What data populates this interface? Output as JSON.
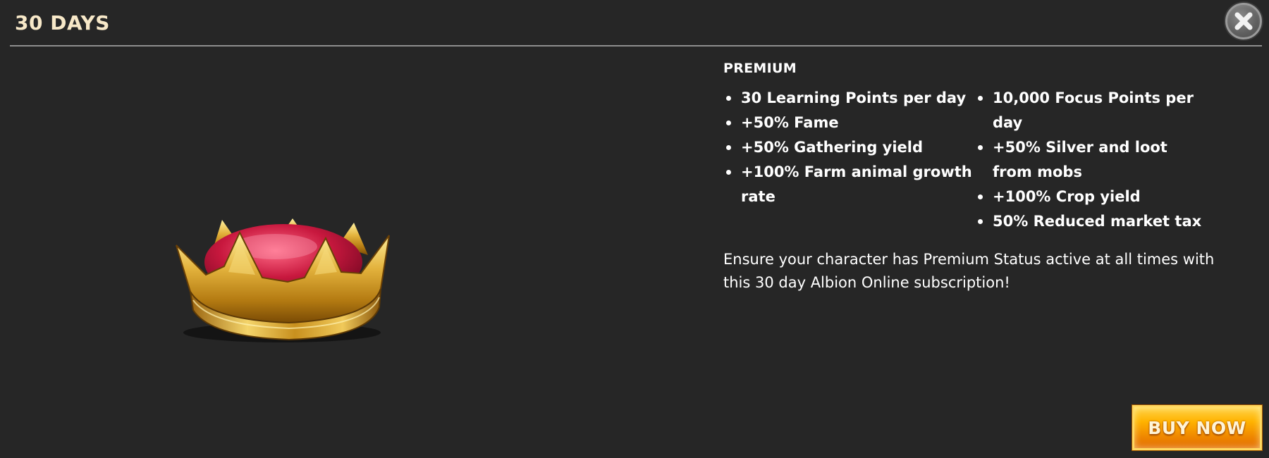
{
  "header": {
    "title": "30 DAYS",
    "close_icon": "close-icon"
  },
  "product": {
    "image_icon": "crown-icon",
    "section_title": "PREMIUM",
    "benefits_col1": [
      "30 Learning Points per day",
      "+50% Fame",
      "+50% Gathering yield",
      "+100% Farm animal growth rate"
    ],
    "benefits_col2": [
      "10,000 Focus Points per day",
      "+50% Silver and loot from mobs",
      "+100% Crop yield",
      "50% Reduced market tax"
    ],
    "description": "Ensure your character has Premium Status active at all times with this 30 day Albion Online subscription!"
  },
  "actions": {
    "buy_label": "BUY NOW"
  },
  "colors": {
    "background": "#262626",
    "title": "#f7e8c8",
    "divider": "#8e8e8e",
    "buy_button": "#ffb300"
  }
}
